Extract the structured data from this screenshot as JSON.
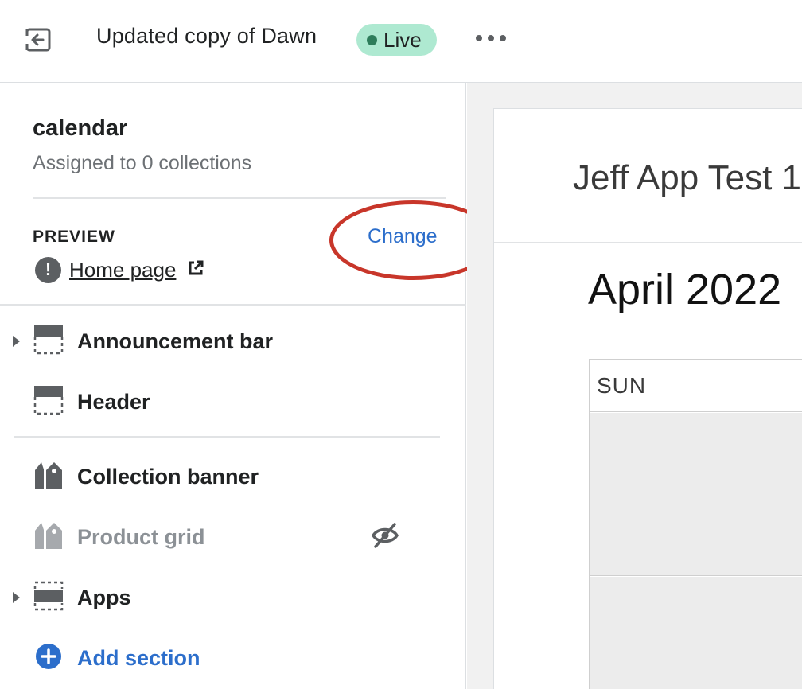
{
  "topbar": {
    "exit_icon": "exit-icon",
    "theme_title": "Updated copy of Dawn",
    "live_badge": "Live",
    "more_icon": "more-horizontal-icon"
  },
  "sidebar": {
    "template_name": "calendar",
    "template_sub": "Assigned to 0 collections",
    "preview_label": "PREVIEW",
    "change_label": "Change",
    "home_link": "Home page",
    "sections": [
      {
        "label": "Announcement bar",
        "icon": "header-section-icon",
        "expandable": true
      },
      {
        "label": "Header",
        "icon": "header-section-icon",
        "expandable": false
      },
      {
        "label": "Collection banner",
        "icon": "tag-icon",
        "expandable": false
      },
      {
        "label": "Product grid",
        "icon": "tag-icon",
        "expandable": false,
        "hidden": true
      },
      {
        "label": "Apps",
        "icon": "apps-section-icon",
        "expandable": true
      }
    ],
    "add_section": "Add section"
  },
  "preview": {
    "store_name": "Jeff App Test 1",
    "month_title": "April 2022",
    "day_header": "SUN"
  },
  "colors": {
    "accent": "#2c6ecb",
    "live_badge_bg": "#aee9d1",
    "live_dot": "#2e7d5b",
    "annotation": "#c8362a"
  }
}
